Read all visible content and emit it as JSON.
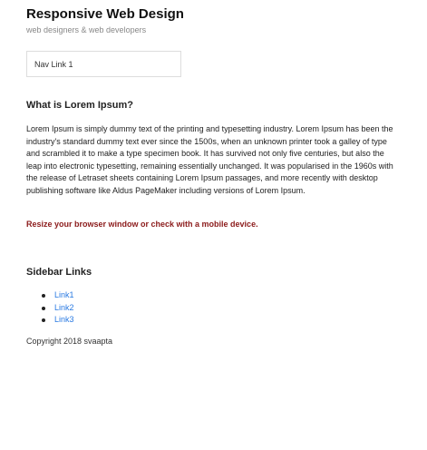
{
  "header": {
    "title": "Responsive Web Design",
    "tagline": "web designers & web developers"
  },
  "nav": {
    "links": [
      {
        "label": "Nav Link 1"
      }
    ]
  },
  "main": {
    "heading": "What is Lorem Ipsum?",
    "paragraph": "Lorem Ipsum is simply dummy text of the printing and typesetting industry. Lorem Ipsum has been the industry's standard dummy text ever since the 1500s, when an unknown printer took a galley of type and scrambled it to make a type specimen book. It has survived not only five centuries, but also the leap into electronic typesetting, remaining essentially unchanged. It was popularised in the 1960s with the release of Letraset sheets containing Lorem Ipsum passages, and more recently with desktop publishing software like Aldus PageMaker including versions of Lorem Ipsum.",
    "notice": "Resize your browser window or check with a mobile device."
  },
  "sidebar": {
    "heading": "Sidebar Links",
    "links": [
      {
        "label": "Link1"
      },
      {
        "label": "Link2"
      },
      {
        "label": "Link3"
      }
    ]
  },
  "footer": {
    "copyright": "Copyright 2018 svaapta"
  },
  "colors": {
    "notice": "#8b1a1a",
    "link": "#2a7ae2",
    "nav_border": "#dddddd"
  }
}
